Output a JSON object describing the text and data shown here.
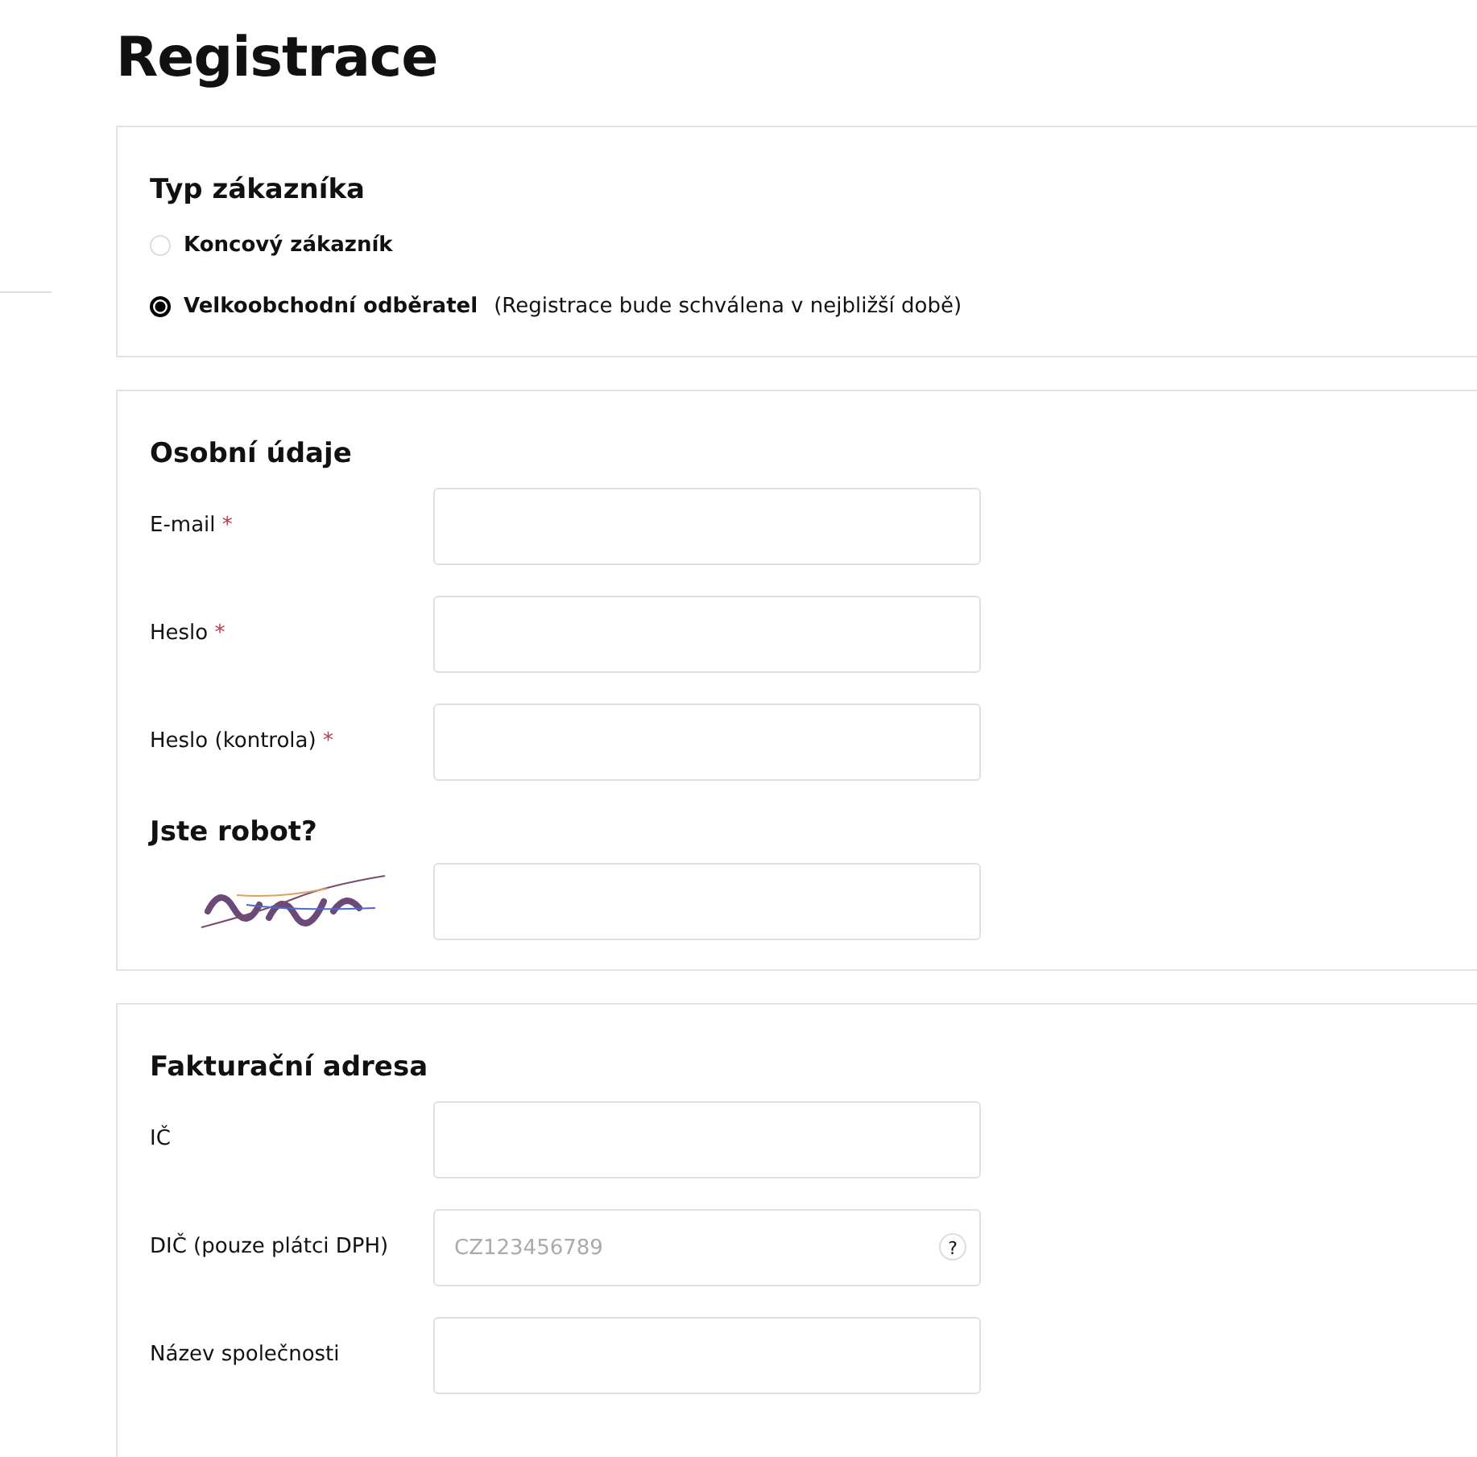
{
  "page_title": "Registrace",
  "customer_type": {
    "heading": "Typ zákazníka",
    "options": [
      {
        "label": "Koncový zákazník",
        "selected": false
      },
      {
        "label": "Velkoobchodní odběratel",
        "note": "(Registrace bude schválena v nejbližší době)",
        "selected": true
      }
    ]
  },
  "personal": {
    "heading": "Osobní údaje",
    "fields": [
      {
        "label": "E-mail",
        "required_mark": "*"
      },
      {
        "label": "Heslo",
        "required_mark": "*"
      },
      {
        "label": "Heslo (kontrola)",
        "required_mark": "*"
      }
    ],
    "captcha": {
      "heading": "Jste robot?",
      "kind": "picture"
    }
  },
  "billing": {
    "heading": "Fakturační adresa",
    "fields": [
      {
        "label": "IČ"
      },
      {
        "label": "DIČ (pouze plátci DPH)",
        "placeholder": "CZ123456789",
        "help": "?"
      },
      {
        "label": "Název společnosti"
      }
    ]
  }
}
